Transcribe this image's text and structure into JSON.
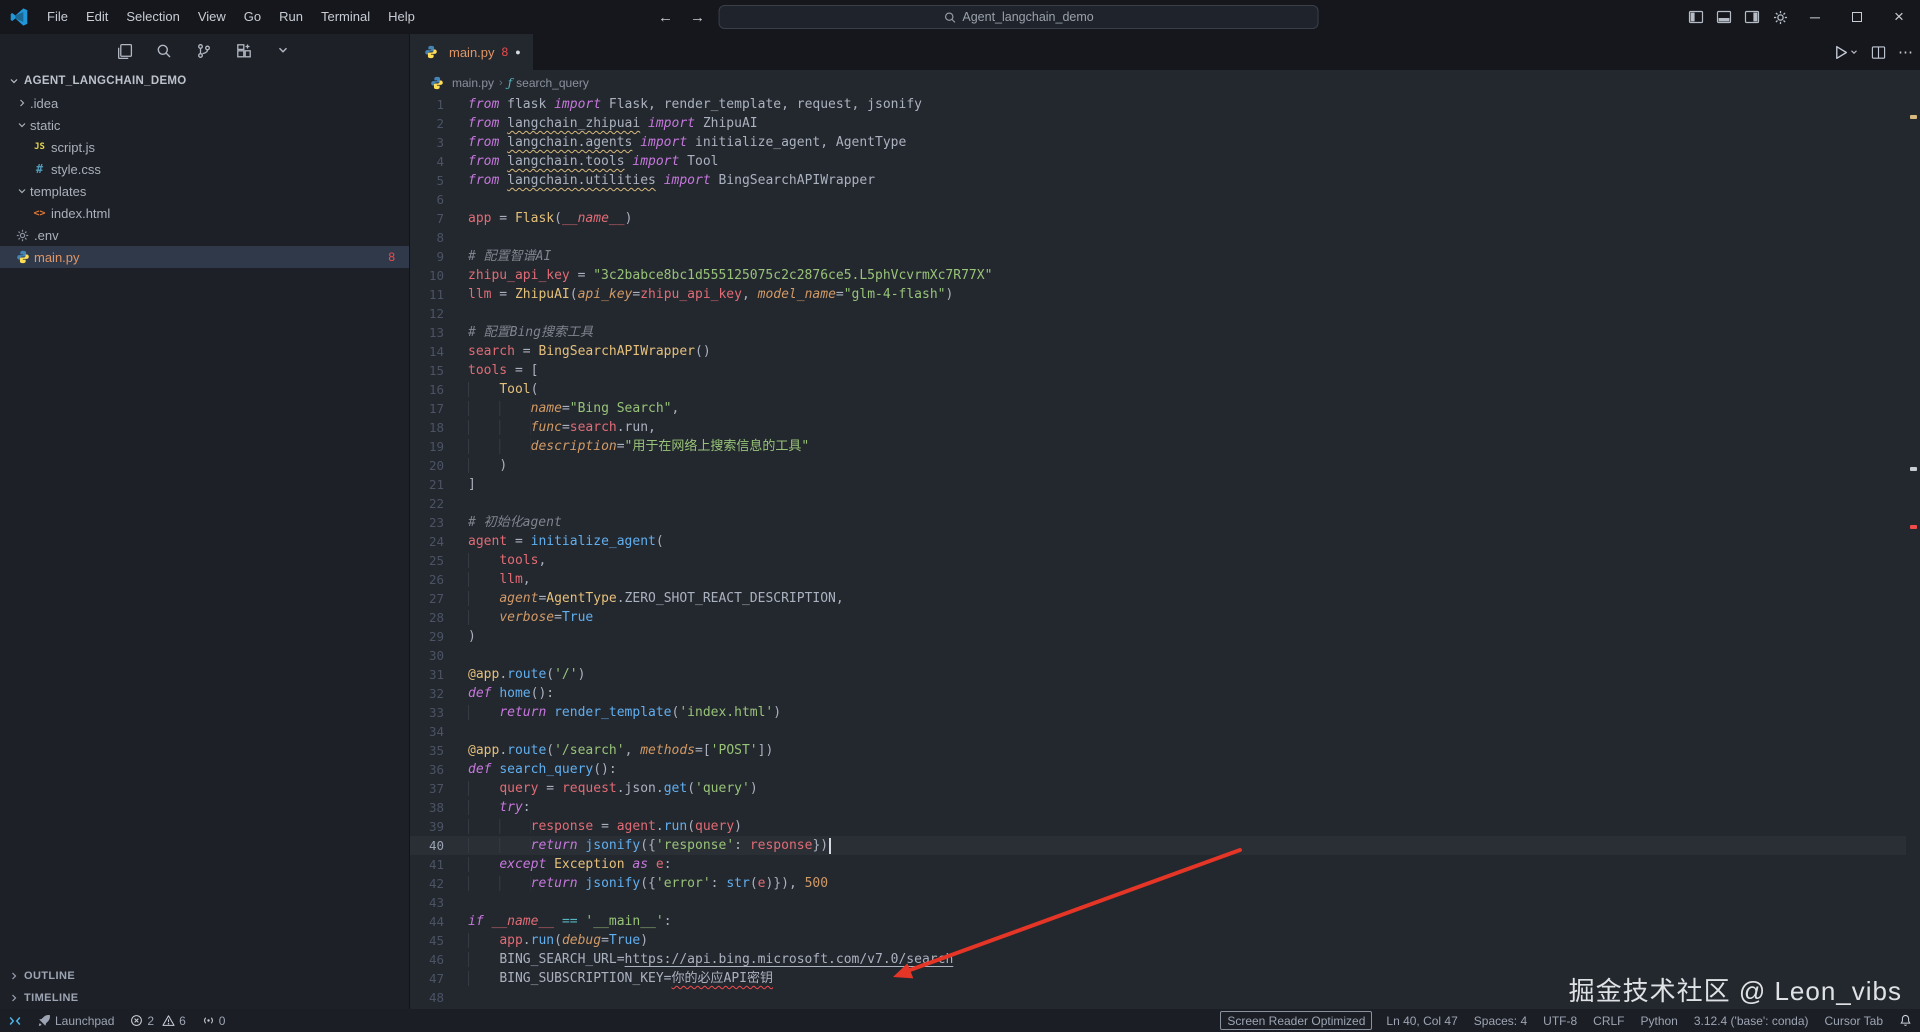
{
  "window": {
    "menus": [
      "File",
      "Edit",
      "Selection",
      "View",
      "Go",
      "Run",
      "Terminal",
      "Help"
    ],
    "search_value": "Agent_langchain_demo"
  },
  "sidebar_toolbar": [
    "copy",
    "search",
    "git-branch",
    "extensions",
    "chevron-down"
  ],
  "explorer": {
    "title": "AGENT_LANGCHAIN_DEMO",
    "items": [
      {
        "kind": "folder",
        "label": ".idea",
        "expanded": false,
        "indent": 0
      },
      {
        "kind": "folder",
        "label": "static",
        "expanded": true,
        "indent": 0
      },
      {
        "kind": "file",
        "label": "script.js",
        "icon": "js",
        "indent": 1
      },
      {
        "kind": "file",
        "label": "style.css",
        "icon": "css",
        "indent": 1
      },
      {
        "kind": "folder",
        "label": "templates",
        "expanded": true,
        "indent": 0
      },
      {
        "kind": "file",
        "label": "index.html",
        "icon": "html",
        "indent": 1
      },
      {
        "kind": "file",
        "label": ".env",
        "icon": "gear",
        "indent": 0
      },
      {
        "kind": "file",
        "label": "main.py",
        "icon": "python",
        "indent": 0,
        "selected": true,
        "error": true,
        "badge": "8"
      }
    ],
    "sections": [
      "OUTLINE",
      "TIMELINE"
    ]
  },
  "editor": {
    "tab": {
      "label": "main.py",
      "problems": "8"
    },
    "breadcrumbs": {
      "file": "main.py",
      "symbol": "search_query"
    },
    "active_line": 40,
    "lines": [
      [
        [
          "k",
          "from"
        ],
        [
          "p",
          " flask "
        ],
        [
          "k",
          "import"
        ],
        [
          "p",
          " Flask, render_template, request, jsonify"
        ]
      ],
      [
        [
          "k",
          "from"
        ],
        [
          "p",
          " "
        ],
        [
          "u",
          "langchain_zhipuai"
        ],
        [
          "p",
          " "
        ],
        [
          "k",
          "import"
        ],
        [
          "p",
          " ZhipuAI"
        ]
      ],
      [
        [
          "k",
          "from"
        ],
        [
          "p",
          " "
        ],
        [
          "u",
          "langchain.agents"
        ],
        [
          "p",
          " "
        ],
        [
          "k",
          "import"
        ],
        [
          "p",
          " initialize_agent, AgentType"
        ]
      ],
      [
        [
          "k",
          "from"
        ],
        [
          "p",
          " "
        ],
        [
          "u",
          "langchain.tools"
        ],
        [
          "p",
          " "
        ],
        [
          "k",
          "import"
        ],
        [
          "p",
          " Tool"
        ]
      ],
      [
        [
          "k",
          "from"
        ],
        [
          "p",
          " "
        ],
        [
          "u",
          "langchain.utilities"
        ],
        [
          "p",
          " "
        ],
        [
          "k",
          "import"
        ],
        [
          "p",
          " BingSearchAPIWrapper"
        ]
      ],
      [],
      [
        [
          "v",
          "app"
        ],
        [
          "p",
          " = "
        ],
        [
          "c",
          "Flask"
        ],
        [
          "p",
          "("
        ],
        [
          "g",
          "__name__"
        ],
        [
          "p",
          ")"
        ]
      ],
      [],
      [
        [
          "m",
          "# 配置智谱AI"
        ]
      ],
      [
        [
          "v",
          "zhipu_api_key"
        ],
        [
          "p",
          " = "
        ],
        [
          "s",
          "\"3c2babce8bc1d555125075c2c2876ce5.L5phVcvrmXc7R77X\""
        ]
      ],
      [
        [
          "v",
          "llm"
        ],
        [
          "p",
          " = "
        ],
        [
          "c",
          "ZhipuAI"
        ],
        [
          "p",
          "("
        ],
        [
          "a",
          "api_key"
        ],
        [
          "p",
          "="
        ],
        [
          "v",
          "zhipu_api_key"
        ],
        [
          "p",
          ", "
        ],
        [
          "a",
          "model_name"
        ],
        [
          "p",
          "="
        ],
        [
          "s",
          "\"glm-4-flash\""
        ],
        [
          "p",
          ")"
        ]
      ],
      [],
      [
        [
          "m",
          "# 配置Bing搜索工具"
        ]
      ],
      [
        [
          "v",
          "search"
        ],
        [
          "p",
          " = "
        ],
        [
          "c",
          "BingSearchAPIWrapper"
        ],
        [
          "p",
          "()"
        ]
      ],
      [
        [
          "v",
          "tools"
        ],
        [
          "p",
          " = ["
        ]
      ],
      [
        [
          "w",
          "    "
        ],
        [
          "c",
          "Tool"
        ],
        [
          "p",
          "("
        ]
      ],
      [
        [
          "w",
          "        "
        ],
        [
          "a",
          "name"
        ],
        [
          "p",
          "="
        ],
        [
          "s",
          "\"Bing Search\""
        ],
        [
          "p",
          ","
        ]
      ],
      [
        [
          "w",
          "        "
        ],
        [
          "a",
          "func"
        ],
        [
          "p",
          "="
        ],
        [
          "v",
          "search"
        ],
        [
          "p",
          ".run,"
        ]
      ],
      [
        [
          "w",
          "        "
        ],
        [
          "a",
          "description"
        ],
        [
          "p",
          "="
        ],
        [
          "s",
          "\"用于在网络上搜索信息的工具\""
        ]
      ],
      [
        [
          "w",
          "    "
        ],
        [
          "p",
          ")"
        ]
      ],
      [
        [
          "p",
          "]"
        ]
      ],
      [],
      [
        [
          "m",
          "# 初始化agent"
        ]
      ],
      [
        [
          "v",
          "agent"
        ],
        [
          "p",
          " = "
        ],
        [
          "f",
          "initialize_agent"
        ],
        [
          "p",
          "("
        ]
      ],
      [
        [
          "w",
          "    "
        ],
        [
          "v",
          "tools"
        ],
        [
          "p",
          ","
        ]
      ],
      [
        [
          "w",
          "    "
        ],
        [
          "v",
          "llm"
        ],
        [
          "p",
          ","
        ]
      ],
      [
        [
          "w",
          "    "
        ],
        [
          "a",
          "agent"
        ],
        [
          "p",
          "="
        ],
        [
          "c",
          "AgentType"
        ],
        [
          "p",
          ".ZERO_SHOT_REACT_DESCRIPTION,"
        ]
      ],
      [
        [
          "w",
          "    "
        ],
        [
          "a",
          "verbose"
        ],
        [
          "p",
          "="
        ],
        [
          "t",
          "True"
        ]
      ],
      [
        [
          "p",
          ")"
        ]
      ],
      [],
      [
        [
          "d",
          "@app"
        ],
        [
          "p",
          "."
        ],
        [
          "f",
          "route"
        ],
        [
          "p",
          "("
        ],
        [
          "s",
          "'/'"
        ],
        [
          "p",
          ")"
        ]
      ],
      [
        [
          "k",
          "def"
        ],
        [
          "p",
          " "
        ],
        [
          "f",
          "home"
        ],
        [
          "p",
          "():"
        ]
      ],
      [
        [
          "w",
          "    "
        ],
        [
          "k",
          "return"
        ],
        [
          "p",
          " "
        ],
        [
          "f",
          "render_template"
        ],
        [
          "p",
          "("
        ],
        [
          "s",
          "'index.html'"
        ],
        [
          "p",
          ")"
        ]
      ],
      [],
      [
        [
          "d",
          "@app"
        ],
        [
          "p",
          "."
        ],
        [
          "f",
          "route"
        ],
        [
          "p",
          "("
        ],
        [
          "s",
          "'/search'"
        ],
        [
          "p",
          ", "
        ],
        [
          "a",
          "methods"
        ],
        [
          "p",
          "=["
        ],
        [
          "s",
          "'POST'"
        ],
        [
          "p",
          "])"
        ]
      ],
      [
        [
          "k",
          "def"
        ],
        [
          "p",
          " "
        ],
        [
          "f",
          "search_query"
        ],
        [
          "p",
          "():"
        ]
      ],
      [
        [
          "w",
          "    "
        ],
        [
          "v",
          "query"
        ],
        [
          "p",
          " = "
        ],
        [
          "v",
          "request"
        ],
        [
          "p",
          ".json."
        ],
        [
          "f",
          "get"
        ],
        [
          "p",
          "("
        ],
        [
          "s",
          "'query'"
        ],
        [
          "p",
          ")"
        ]
      ],
      [
        [
          "w",
          "    "
        ],
        [
          "k",
          "try"
        ],
        [
          "p",
          ":"
        ]
      ],
      [
        [
          "w",
          "        "
        ],
        [
          "v",
          "response"
        ],
        [
          "p",
          " = "
        ],
        [
          "v",
          "agent"
        ],
        [
          "p",
          "."
        ],
        [
          "f",
          "run"
        ],
        [
          "p",
          "("
        ],
        [
          "v",
          "query"
        ],
        [
          "p",
          ")"
        ]
      ],
      [
        [
          "w",
          "        "
        ],
        [
          "k",
          "return"
        ],
        [
          "p",
          " "
        ],
        [
          "f",
          "jsonify"
        ],
        [
          "p",
          "({"
        ],
        [
          "s",
          "'response'"
        ],
        [
          "p",
          ": "
        ],
        [
          "v",
          "response"
        ],
        [
          "p",
          "})"
        ],
        [
          "x",
          ""
        ]
      ],
      [
        [
          "w",
          "    "
        ],
        [
          "k",
          "except"
        ],
        [
          "p",
          " "
        ],
        [
          "c",
          "Exception"
        ],
        [
          "p",
          " "
        ],
        [
          "k",
          "as"
        ],
        [
          "p",
          " "
        ],
        [
          "v",
          "e"
        ],
        [
          "p",
          ":"
        ]
      ],
      [
        [
          "w",
          "        "
        ],
        [
          "k",
          "return"
        ],
        [
          "p",
          " "
        ],
        [
          "f",
          "jsonify"
        ],
        [
          "p",
          "({"
        ],
        [
          "s",
          "'error'"
        ],
        [
          "p",
          ": "
        ],
        [
          "f",
          "str"
        ],
        [
          "p",
          "("
        ],
        [
          "v",
          "e"
        ],
        [
          "p",
          ")}), "
        ],
        [
          "n",
          "500"
        ]
      ],
      [],
      [
        [
          "k",
          "if"
        ],
        [
          "p",
          " "
        ],
        [
          "g",
          "__name__"
        ],
        [
          "p",
          " "
        ],
        [
          "o",
          "=="
        ],
        [
          "p",
          " "
        ],
        [
          "s",
          "'__main__'"
        ],
        [
          "p",
          ":"
        ]
      ],
      [
        [
          "w",
          "    "
        ],
        [
          "v",
          "app"
        ],
        [
          "p",
          "."
        ],
        [
          "f",
          "run"
        ],
        [
          "p",
          "("
        ],
        [
          "a",
          "debug"
        ],
        [
          "p",
          "="
        ],
        [
          "t",
          "True"
        ],
        [
          "p",
          ")"
        ]
      ],
      [
        [
          "w",
          "    "
        ],
        [
          "p",
          "BING_SEARCH_URL="
        ],
        [
          "l",
          "https://api.bing.microsoft.com/v7.0/search"
        ]
      ],
      [
        [
          "w",
          "    "
        ],
        [
          "p",
          "BING_SUBSCRIPTION_KEY="
        ],
        [
          "e",
          "你的必应API密钥"
        ]
      ],
      []
    ]
  },
  "status_bar": {
    "launchpad": "Launchpad",
    "errors": "2",
    "warnings": "6",
    "ports": "0",
    "screen_reader": "Screen Reader Optimized",
    "cursor_position": "Ln 40, Col 47",
    "indentation": "Spaces: 4",
    "encoding": "UTF-8",
    "eol": "CRLF",
    "language": "Python",
    "interpreter": "3.12.4 ('base': conda)",
    "cursor_tab": "Cursor Tab"
  },
  "watermark": "掘金技术社区 @ Leon_vibs",
  "colors": {
    "error": "#f14c4c",
    "warning": "#d7ba7d",
    "arrow": "#e53526",
    "accent": "#61afef"
  }
}
